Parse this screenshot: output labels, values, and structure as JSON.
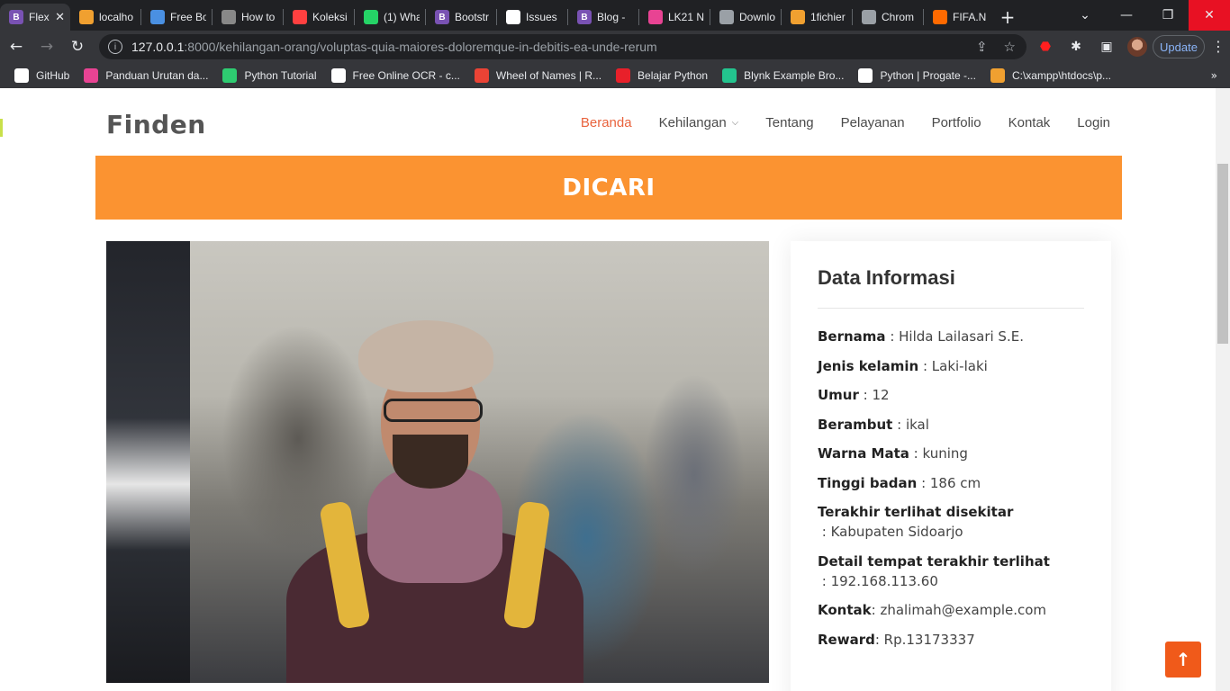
{
  "browser": {
    "tabs": [
      {
        "title": "Flex",
        "favicon_letter": "B",
        "favicon_color": "#7952b3",
        "active": true
      },
      {
        "title": "localho",
        "favicon_letter": "",
        "favicon_color": "#f0a030"
      },
      {
        "title": "Free Bo",
        "favicon_letter": "",
        "favicon_color": "#4a90e2"
      },
      {
        "title": "How to",
        "favicon_letter": "",
        "favicon_color": "#888888"
      },
      {
        "title": "Koleksi",
        "favicon_letter": "",
        "favicon_color": "#ff4040"
      },
      {
        "title": "(1) Wha",
        "favicon_letter": "",
        "favicon_color": "#25d366"
      },
      {
        "title": "Bootstr",
        "favicon_letter": "B",
        "favicon_color": "#7952b3"
      },
      {
        "title": "Issues",
        "favicon_letter": "",
        "favicon_color": "#ffffff"
      },
      {
        "title": "Blog -",
        "favicon_letter": "B",
        "favicon_color": "#7952b3"
      },
      {
        "title": "LK21 N",
        "favicon_letter": "",
        "favicon_color": "#e84393"
      },
      {
        "title": "Downlo",
        "favicon_letter": "",
        "favicon_color": "#9aa0a6"
      },
      {
        "title": "1fichier",
        "favicon_letter": "",
        "favicon_color": "#f0a030"
      },
      {
        "title": "Chrom",
        "favicon_letter": "",
        "favicon_color": "#9aa0a6"
      },
      {
        "title": "FIFA.N",
        "favicon_letter": "",
        "favicon_color": "#ff6a00"
      }
    ],
    "url_host": "127.0.0.1",
    "url_path": ":8000/kehilangan-orang/voluptas-quia-maiores-doloremque-in-debitis-ea-unde-rerum",
    "update_label": "Update",
    "bookmarks": [
      {
        "label": "GitHub",
        "color": "#ffffff"
      },
      {
        "label": "Panduan Urutan da...",
        "color": "#e84393"
      },
      {
        "label": "Python Tutorial",
        "color": "#2ecc71"
      },
      {
        "label": "Free Online OCR - c...",
        "color": "#ffffff"
      },
      {
        "label": "Wheel of Names | R...",
        "color": "#ea4335"
      },
      {
        "label": "Belajar Python",
        "color": "#e8202a"
      },
      {
        "label": "Blynk Example Bro...",
        "color": "#23c48e"
      },
      {
        "label": "Python | Progate -...",
        "color": "#ffffff"
      },
      {
        "label": "C:\\xampp\\htdocs\\p...",
        "color": "#f0a030"
      }
    ]
  },
  "site": {
    "logo": "Finden",
    "nav": [
      {
        "label": "Beranda",
        "active": true
      },
      {
        "label": "Kehilangan",
        "dropdown": true
      },
      {
        "label": "Tentang"
      },
      {
        "label": "Pelayanan"
      },
      {
        "label": "Portfolio"
      },
      {
        "label": "Kontak"
      },
      {
        "label": "Login"
      }
    ],
    "banner_title": "DICARI",
    "accent_color": "#fb9331"
  },
  "info": {
    "title": "Data Informasi",
    "rows": [
      {
        "label": "Bernama",
        "sep": " : ",
        "value": "Hilda Lailasari S.E."
      },
      {
        "label": "Jenis kelamin",
        "sep": " : ",
        "value": "Laki-laki"
      },
      {
        "label": "Umur",
        "sep": " : ",
        "value": "12"
      },
      {
        "label": "Berambut",
        "sep": " : ",
        "value": "ikal"
      },
      {
        "label": "Warna Mata",
        "sep": " : ",
        "value": "kuning"
      },
      {
        "label": "Tinggi badan",
        "sep": " : ",
        "value": "186 cm"
      },
      {
        "label": "Terakhir terlihat disekitar",
        "sep": " : ",
        "value": "Kabupaten Sidoarjo"
      },
      {
        "label": "Detail tempat terakhir terlihat",
        "sep": " : ",
        "value": "192.168.113.60"
      },
      {
        "label": "Kontak",
        "sep": ": ",
        "value": "zhalimah@example.com"
      },
      {
        "label": "Reward",
        "sep": ": ",
        "value": "Rp.13173337"
      }
    ]
  }
}
